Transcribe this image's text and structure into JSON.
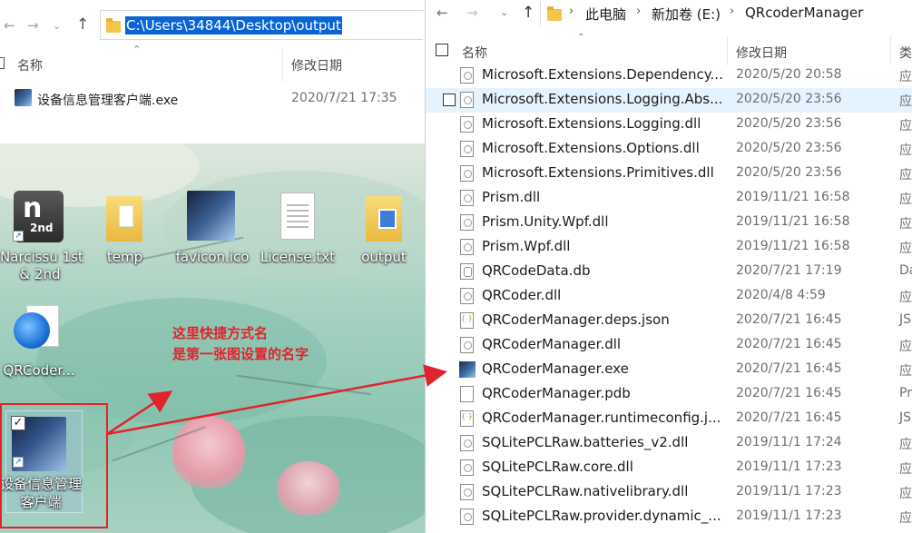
{
  "left_window": {
    "address_path": "C:\\Users\\34844\\Desktop\\output",
    "columns": {
      "name": "名称",
      "date": "修改日期"
    },
    "files": [
      {
        "name": "设备信息管理客户端.exe",
        "date": "2020/7/21 17:35"
      }
    ]
  },
  "desktop": {
    "icons": [
      {
        "label_line1": "Narcissu 1st",
        "label_line2": "& 2nd"
      },
      {
        "label_line1": "temp"
      },
      {
        "label_line1": "favicon.ico"
      },
      {
        "label_line1": "License.txt"
      },
      {
        "label_line1": "output"
      },
      {
        "label_line1": "QRCoder..."
      },
      {
        "label_line1": "设备信息管理",
        "label_line2": "客户端"
      }
    ],
    "annotation": {
      "line1": "这里快捷方式名",
      "line2": "是第一张图设置的名字"
    },
    "colors": {
      "annotation": "#e0232c"
    }
  },
  "right_window": {
    "breadcrumbs": [
      "此电脑",
      "新加卷 (E:)",
      "QRcoderManager"
    ],
    "columns": {
      "name": "名称",
      "date": "修改日期",
      "type": "类"
    },
    "files": [
      {
        "name": "Microsoft.Extensions.Dependency...",
        "date": "2020/5/20 20:58",
        "type": "应",
        "icon": "dll"
      },
      {
        "name": "Microsoft.Extensions.Logging.Abs...",
        "date": "2020/5/20 23:56",
        "type": "应",
        "icon": "dll"
      },
      {
        "name": "Microsoft.Extensions.Logging.dll",
        "date": "2020/5/20 23:56",
        "type": "应",
        "icon": "dll"
      },
      {
        "name": "Microsoft.Extensions.Options.dll",
        "date": "2020/5/20 23:56",
        "type": "应",
        "icon": "dll"
      },
      {
        "name": "Microsoft.Extensions.Primitives.dll",
        "date": "2020/5/20 23:56",
        "type": "应",
        "icon": "dll"
      },
      {
        "name": "Prism.dll",
        "date": "2019/11/21 16:58",
        "type": "应",
        "icon": "dll"
      },
      {
        "name": "Prism.Unity.Wpf.dll",
        "date": "2019/11/21 16:58",
        "type": "应",
        "icon": "dll"
      },
      {
        "name": "Prism.Wpf.dll",
        "date": "2019/11/21 16:58",
        "type": "应",
        "icon": "dll"
      },
      {
        "name": "QRCodeData.db",
        "date": "2020/7/21 17:19",
        "type": "Da",
        "icon": "db"
      },
      {
        "name": "QRCoder.dll",
        "date": "2020/4/8 4:59",
        "type": "应",
        "icon": "dll"
      },
      {
        "name": "QRCoderManager.deps.json",
        "date": "2020/7/21 16:45",
        "type": "JS",
        "icon": "json"
      },
      {
        "name": "QRCoderManager.dll",
        "date": "2020/7/21 16:45",
        "type": "应",
        "icon": "dll"
      },
      {
        "name": "QRCoderManager.exe",
        "date": "2020/7/21 16:45",
        "type": "应",
        "icon": "exe"
      },
      {
        "name": "QRCoderManager.pdb",
        "date": "2020/7/21 16:45",
        "type": "Pr",
        "icon": "file"
      },
      {
        "name": "QRCoderManager.runtimeconfig.j...",
        "date": "2020/7/21 16:45",
        "type": "JS",
        "icon": "json"
      },
      {
        "name": "SQLitePCLRaw.batteries_v2.dll",
        "date": "2019/11/1 17:24",
        "type": "应",
        "icon": "dll"
      },
      {
        "name": "SQLitePCLRaw.core.dll",
        "date": "2019/11/1 17:23",
        "type": "应",
        "icon": "dll"
      },
      {
        "name": "SQLitePCLRaw.nativelibrary.dll",
        "date": "2019/11/1 17:23",
        "type": "应",
        "icon": "dll"
      },
      {
        "name": "SQLitePCLRaw.provider.dynamic_...",
        "date": "2019/11/1 17:23",
        "type": "应",
        "icon": "dll"
      }
    ]
  }
}
